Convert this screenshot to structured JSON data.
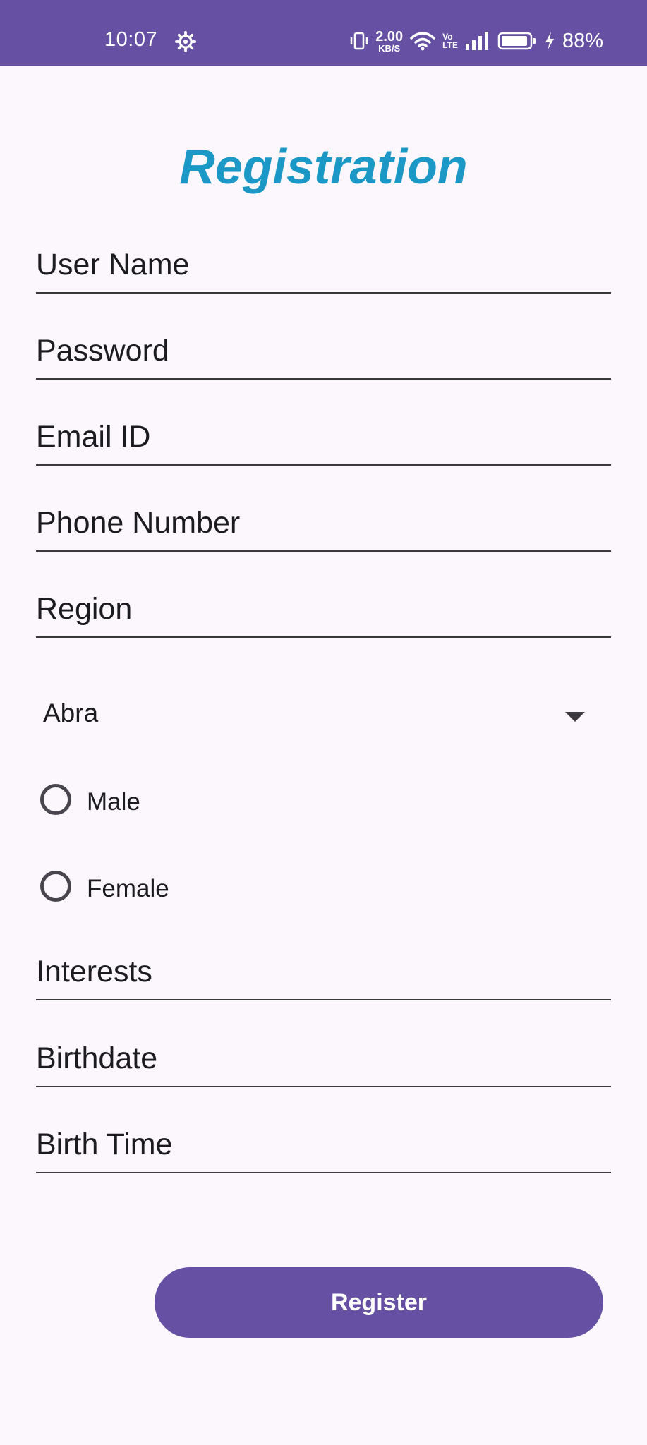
{
  "status_bar": {
    "time": "10:07",
    "speed_value": "2.00",
    "speed_unit": "KB/S",
    "volte_top": "Vo",
    "volte_bottom": "LTE",
    "battery_percent": "88%",
    "icons": [
      "gear-icon",
      "vibrate-icon",
      "wifi-icon",
      "signal-icon",
      "battery-icon",
      "charging-bolt-icon"
    ]
  },
  "form": {
    "title": "Registration",
    "fields": {
      "user_name": "User Name",
      "password": "Password",
      "email": "Email ID",
      "phone": "Phone Number",
      "region": "Region",
      "interests": "Interests",
      "birthdate": "Birthdate",
      "birth_time": "Birth Time"
    },
    "region_spinner": {
      "selected": "Abra"
    },
    "gender": {
      "male": "Male",
      "female": "Female"
    },
    "register_label": "Register"
  },
  "colors": {
    "primary": "#6650a4",
    "title": "#1b98c6",
    "background": "#fcf7fc"
  }
}
